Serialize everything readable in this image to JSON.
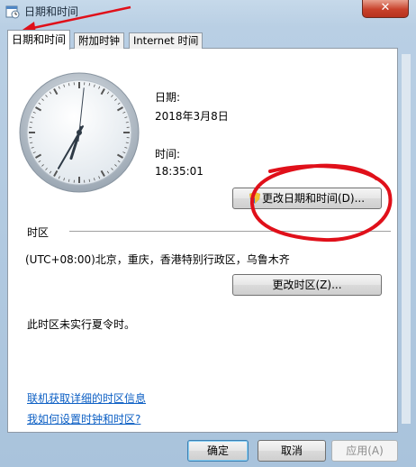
{
  "window": {
    "title": "日期和时间",
    "close_label": "✕"
  },
  "tabs": [
    {
      "label": "日期和时间",
      "active": true
    },
    {
      "label": "附加时钟",
      "active": false
    },
    {
      "label": "Internet 时间",
      "active": false
    }
  ],
  "date_section": {
    "date_label": "日期:",
    "date_value": "2018年3月8日",
    "time_label": "时间:",
    "time_value": "18:35:01",
    "change_datetime_button": "更改日期和时间(D)..."
  },
  "timezone_section": {
    "heading": "时区",
    "current_zone": "(UTC+08:00)北京，重庆，香港特别行政区，乌鲁木齐",
    "change_zone_button": "更改时区(Z)...",
    "dst_note": "此时区未实行夏令时。"
  },
  "links": {
    "online_info": "联机获取详细的时区信息",
    "how_to_set": "我如何设置时钟和时区?"
  },
  "footer": {
    "ok": "确定",
    "cancel": "取消",
    "apply": "应用(A)"
  },
  "clock": {
    "time": "18:35:01"
  },
  "colors": {
    "link": "#0c5fc4",
    "annotation": "#e0101a"
  },
  "icons": [
    "datetime-icon",
    "close-icon",
    "shield-icon",
    "analog-clock"
  ]
}
